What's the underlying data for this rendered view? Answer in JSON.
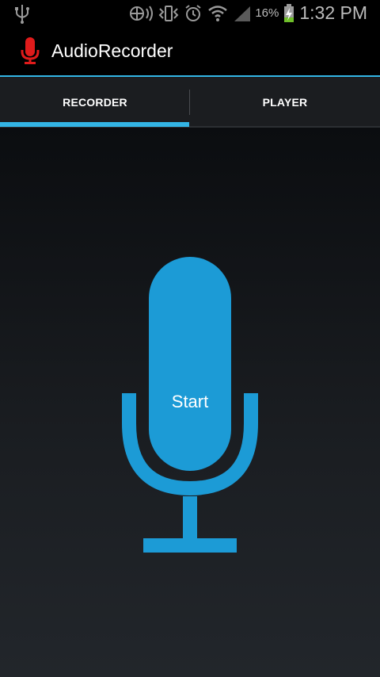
{
  "status_bar": {
    "battery_percent": "16%",
    "time": "1:32 PM",
    "icons": [
      "usb-icon",
      "nfc-icon",
      "vibrate-icon",
      "alarm-icon",
      "wifi-icon",
      "signal-icon",
      "battery-charging-icon"
    ]
  },
  "action_bar": {
    "title": "AudioRecorder",
    "accent_color": "#33b5e5",
    "icon_color": "#e01b1b"
  },
  "tabs": [
    {
      "label": "RECORDER",
      "selected": true
    },
    {
      "label": "PLAYER",
      "selected": false
    }
  ],
  "recorder": {
    "button_label": "Start",
    "mic_color": "#1c9bd6"
  }
}
